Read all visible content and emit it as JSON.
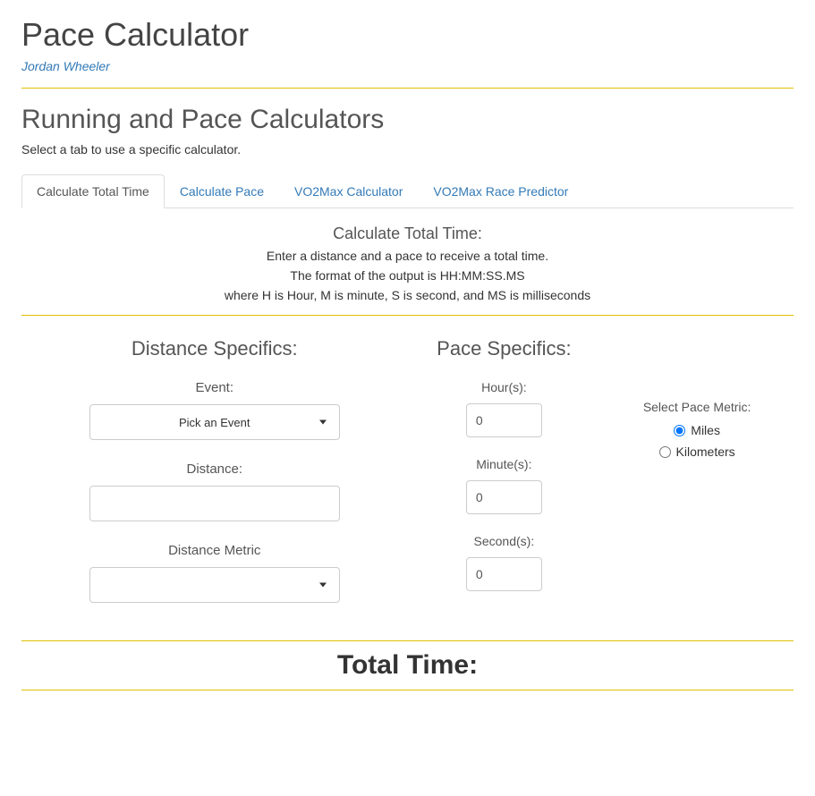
{
  "header": {
    "title": "Pace Calculator",
    "author": "Jordan Wheeler"
  },
  "section": {
    "title": "Running and Pace Calculators",
    "intro": "Select a tab to use a specific calculator."
  },
  "tabs": [
    "Calculate Total Time",
    "Calculate Pace",
    "VO2Max Calculator",
    "VO2Max Race Predictor"
  ],
  "panel": {
    "title": "Calculate Total Time:",
    "line1": "Enter a distance and a pace to receive a total time.",
    "line2": "The format of the output is HH:MM:SS.MS",
    "line3": "where H is Hour, M is minute, S is second, and MS is milliseconds"
  },
  "distance": {
    "heading": "Distance Specifics:",
    "eventLabel": "Event:",
    "eventSelected": "Pick an Event",
    "distanceLabel": "Distance:",
    "distanceValue": "",
    "metricLabel": "Distance Metric",
    "metricSelected": ""
  },
  "pace": {
    "heading": "Pace Specifics:",
    "hoursLabel": "Hour(s):",
    "hoursValue": "0",
    "minutesLabel": "Minute(s):",
    "minutesValue": "0",
    "secondsLabel": "Second(s):",
    "secondsValue": "0",
    "metricLabel": "Select Pace Metric:",
    "option1": "Miles",
    "option2": "Kilometers"
  },
  "result": {
    "label": "Total Time:"
  }
}
